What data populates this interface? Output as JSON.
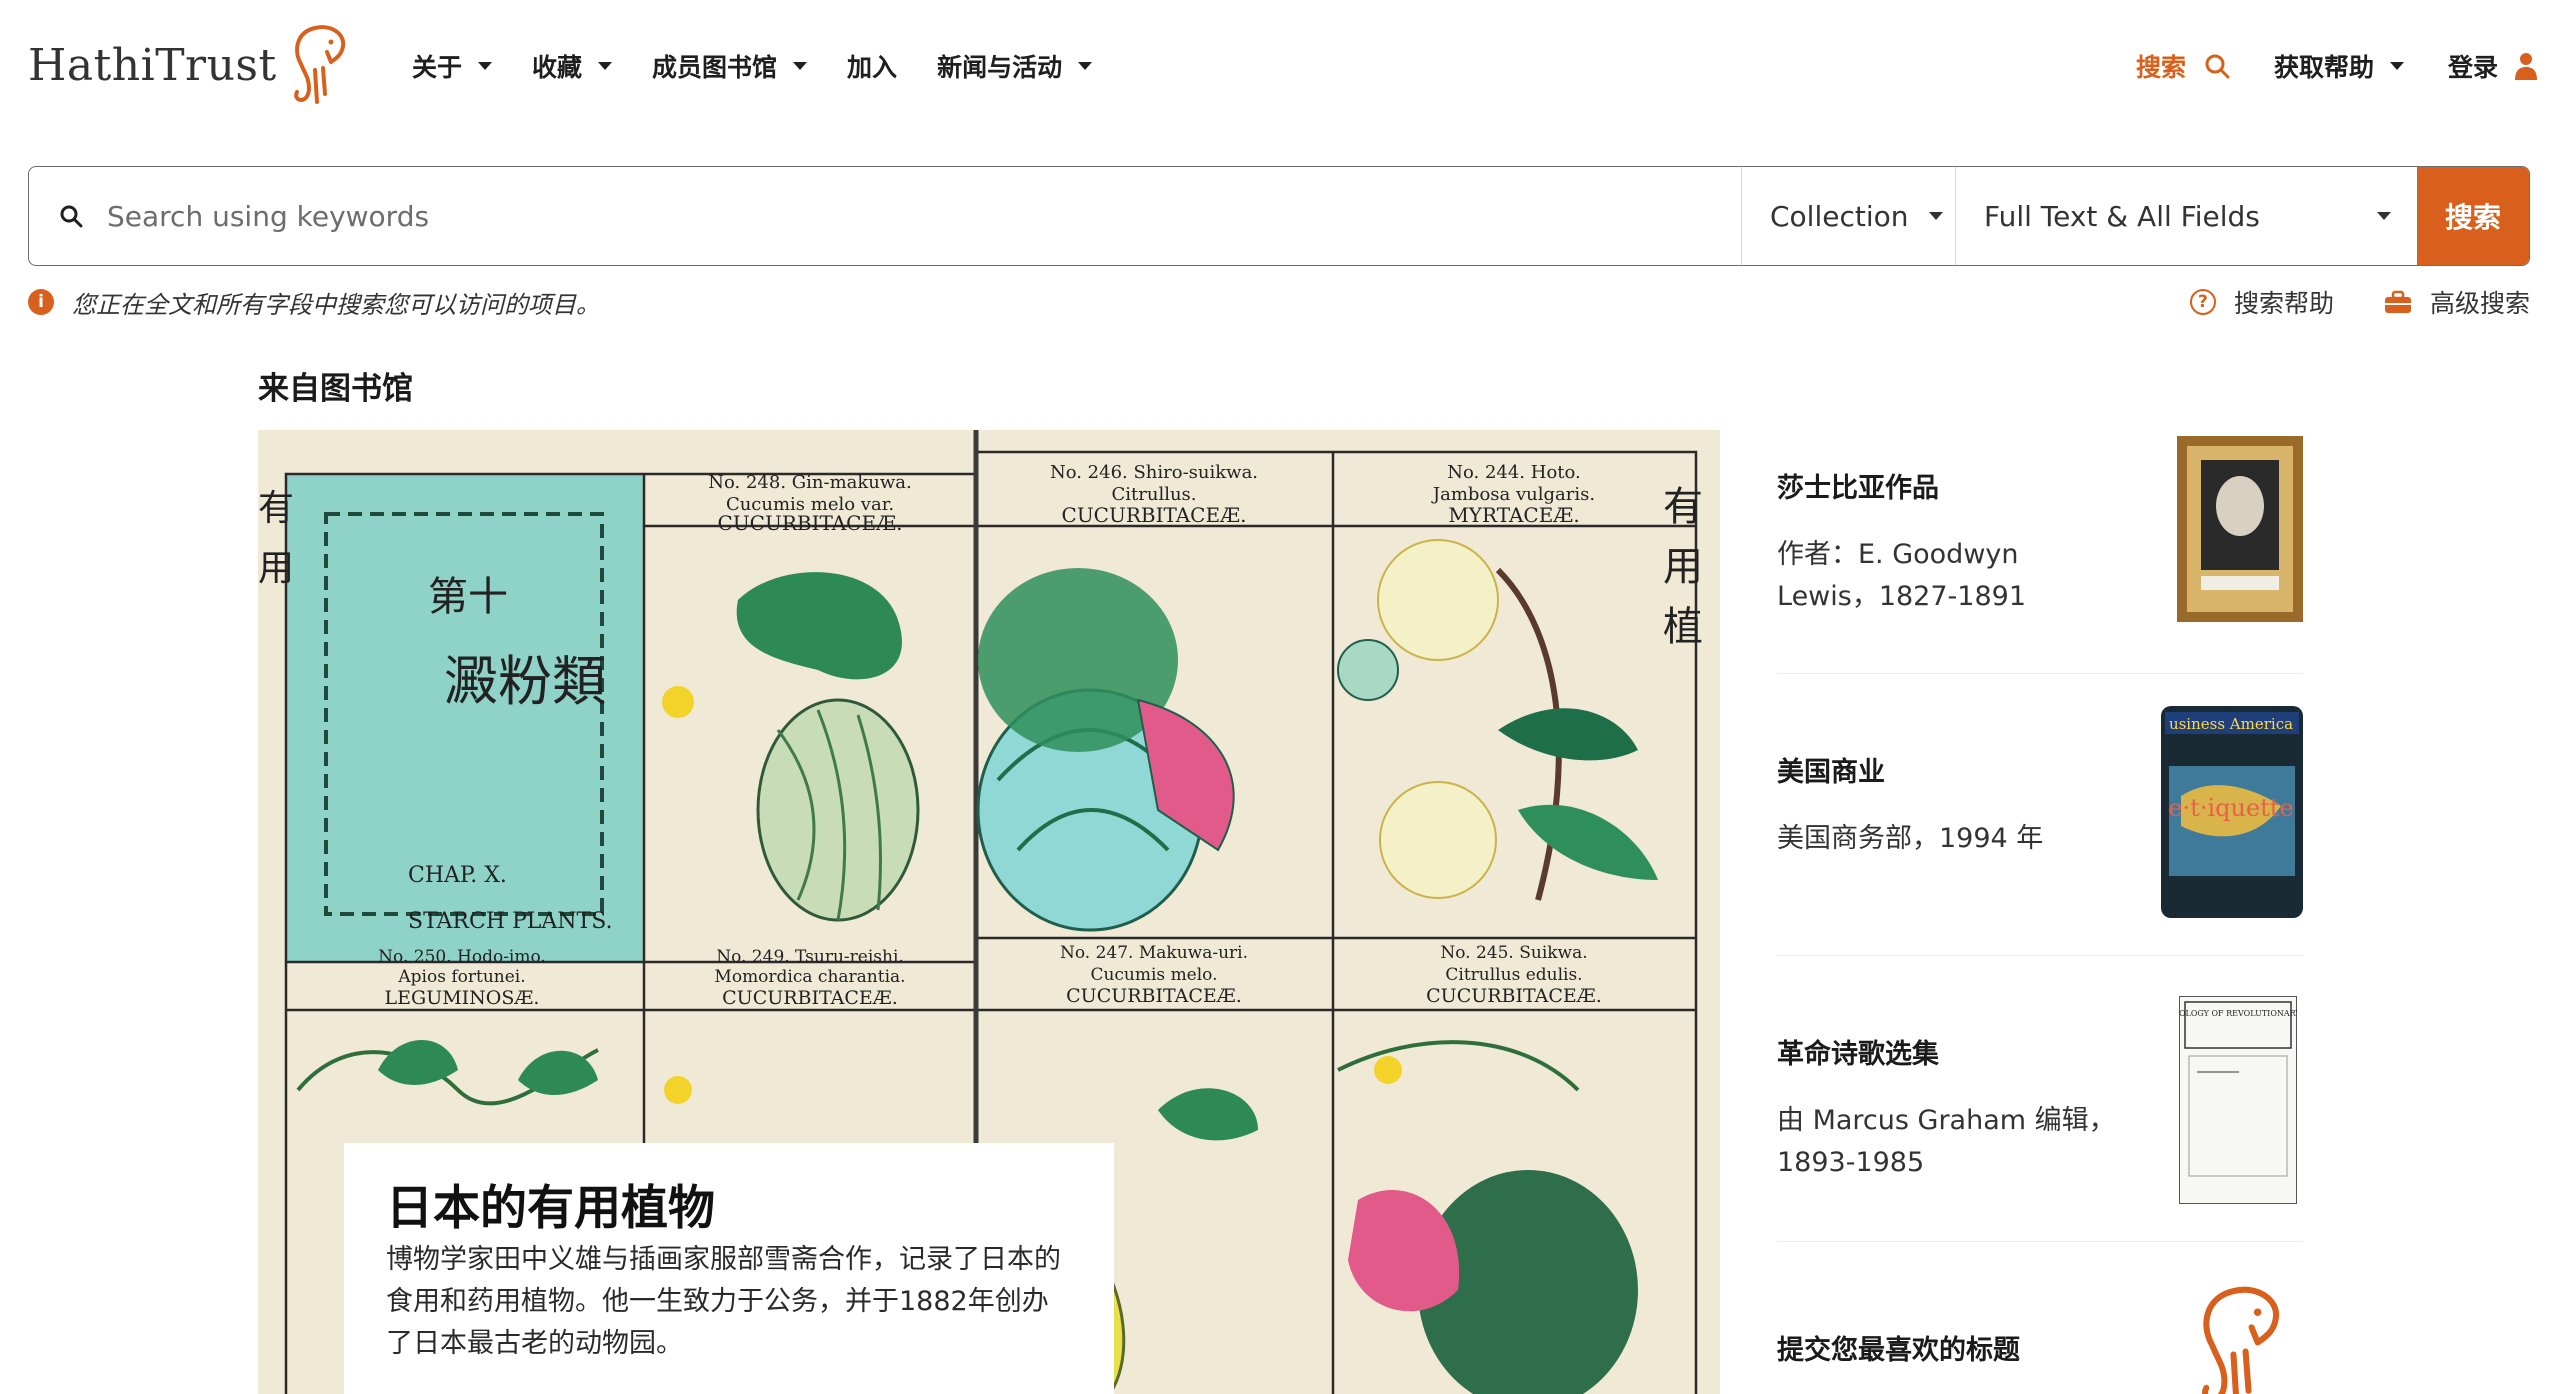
{
  "header": {
    "logo_text": "HathiTrust",
    "nav": [
      {
        "label": "关于",
        "has_caret": true
      },
      {
        "label": "收藏",
        "has_caret": true
      },
      {
        "label": "成员图书馆",
        "has_caret": true
      },
      {
        "label": "加入",
        "has_caret": false
      },
      {
        "label": "新闻与活动",
        "has_caret": true
      }
    ],
    "right_nav": {
      "search_label": "搜索",
      "search_icon": "magnifier-icon",
      "help_label": "获取帮助",
      "login_label": "登录",
      "login_icon": "user-icon"
    }
  },
  "search": {
    "placeholder": "Search using keywords",
    "value": "",
    "collection_selected": "Collection",
    "fields_selected": "Full Text & All Fields",
    "button_label": "搜索"
  },
  "info": {
    "message": "您正在全文和所有字段中搜索您可以访问的项目。",
    "help_link": "搜索帮助",
    "advanced_link": "高级搜索"
  },
  "section_title": "来自图书馆",
  "feature": {
    "title": "日本的有用植物",
    "description": "博物学家田中义雄与插画家服部雪斋合作，记录了日本的食用和药用植物。他一生致力于公务，并于1882年创办了日本最古老的动物园。",
    "image_labels": {
      "chap": "CHAP. X.",
      "starch": "STARCH PLANTS.",
      "p248": "No. 248. Gin-makuwa.",
      "p248_latin": "Cucumis melo var.",
      "p248_family": "CUCURBITACEÆ.",
      "p246": "No. 246. Shiro-suikwa.",
      "p246_latin": "Citrullus.",
      "p246_family": "CUCURBITACEÆ.",
      "p244": "No. 244. Hoto.",
      "p244_latin": "Jambosa vulgaris.",
      "p244_family": "MYRTACEÆ.",
      "p250": "No. 250. Hodo-imo.",
      "p250_latin": "Apios fortunei.",
      "p250_family": "LEGUMINOSÆ.",
      "p249": "No. 249. Tsuru-reishi.",
      "p249_latin": "Momordica charantia.",
      "p249_family": "CUCURBITACEÆ.",
      "p247": "No. 247. Makuwa-uri.",
      "p247_latin": "Cucumis melo.",
      "p247_family": "CUCURBITACEÆ.",
      "p245": "No. 245. Suikwa.",
      "p245_latin": "Citrullus edulis.",
      "p245_family": "CUCURBITACEÆ.",
      "kanji_title": "澱粉類"
    }
  },
  "side_items": [
    {
      "title": "莎士比亚作品",
      "desc": "作者：E. Goodwyn Lewis，1827-1891"
    },
    {
      "title": "美国商业",
      "desc": "美国商务部，1994 年",
      "thumb_text1": "usiness America",
      "thumb_text2": "e·t·iquette"
    },
    {
      "title": "革命诗歌选集",
      "desc": "由 Marcus Graham 编辑，1893-1985",
      "thumb_text1": "AN ANTHOLOGY OF REVOLUTIONARY POETRY"
    },
    {
      "title": "提交您最喜欢的标题",
      "desc": ""
    }
  ],
  "colors": {
    "accent": "#d8601c",
    "text": "#212121",
    "border": "#6e6e6e"
  }
}
